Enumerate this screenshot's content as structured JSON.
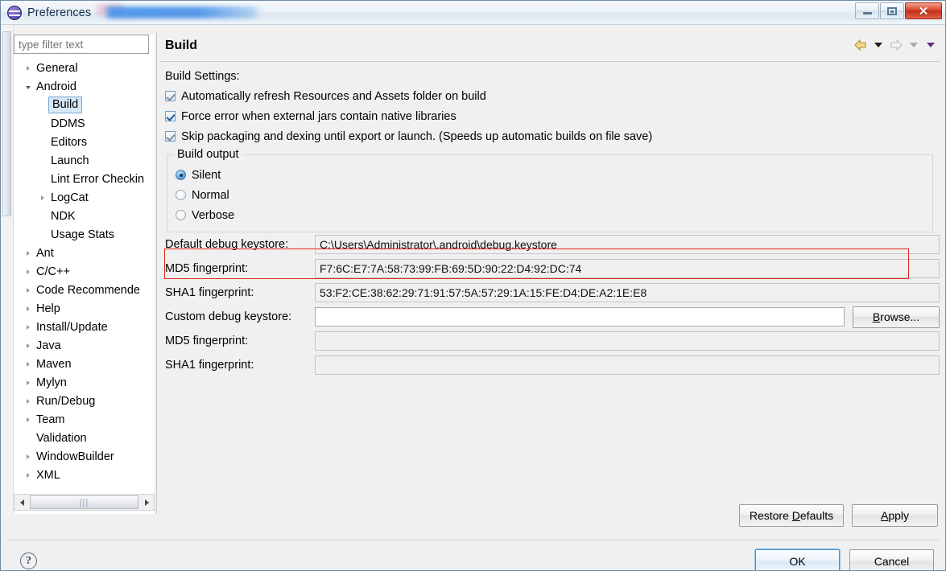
{
  "window": {
    "title": "Preferences",
    "icon": "eclipse-icon",
    "redacted_title_suffix": "",
    "controls": {
      "minimize": "minimize-button",
      "restore": "restore-button",
      "close": "✕"
    }
  },
  "sidebar": {
    "filter_placeholder": "type filter text",
    "filter_value": "",
    "selected": "Build",
    "items": [
      {
        "label": "General",
        "depth": 0,
        "twisty": "collapsed"
      },
      {
        "label": "Android",
        "depth": 0,
        "twisty": "expanded"
      },
      {
        "label": "Build",
        "depth": 1,
        "twisty": "none",
        "selected": true
      },
      {
        "label": "DDMS",
        "depth": 1,
        "twisty": "none"
      },
      {
        "label": "Editors",
        "depth": 1,
        "twisty": "none"
      },
      {
        "label": "Launch",
        "depth": 1,
        "twisty": "none"
      },
      {
        "label": "Lint Error Checkin",
        "depth": 1,
        "twisty": "none"
      },
      {
        "label": "LogCat",
        "depth": 1,
        "twisty": "collapsed"
      },
      {
        "label": "NDK",
        "depth": 1,
        "twisty": "none"
      },
      {
        "label": "Usage Stats",
        "depth": 1,
        "twisty": "none"
      },
      {
        "label": "Ant",
        "depth": 0,
        "twisty": "collapsed"
      },
      {
        "label": "C/C++",
        "depth": 0,
        "twisty": "collapsed"
      },
      {
        "label": "Code Recommende",
        "depth": 0,
        "twisty": "collapsed"
      },
      {
        "label": "Help",
        "depth": 0,
        "twisty": "collapsed"
      },
      {
        "label": "Install/Update",
        "depth": 0,
        "twisty": "collapsed"
      },
      {
        "label": "Java",
        "depth": 0,
        "twisty": "collapsed"
      },
      {
        "label": "Maven",
        "depth": 0,
        "twisty": "collapsed"
      },
      {
        "label": "Mylyn",
        "depth": 0,
        "twisty": "collapsed"
      },
      {
        "label": "Run/Debug",
        "depth": 0,
        "twisty": "collapsed"
      },
      {
        "label": "Team",
        "depth": 0,
        "twisty": "collapsed"
      },
      {
        "label": "Validation",
        "depth": 0,
        "twisty": "none"
      },
      {
        "label": "WindowBuilder",
        "depth": 0,
        "twisty": "collapsed"
      },
      {
        "label": "XML",
        "depth": 0,
        "twisty": "collapsed"
      }
    ]
  },
  "page": {
    "title": "Build",
    "nav": {
      "back": "back-arrow-icon",
      "back_menu": "back-dropdown-icon",
      "forward": "forward-arrow-icon",
      "forward_menu": "forward-dropdown-icon",
      "view_menu": "view-menu-dropdown-icon"
    },
    "build_settings_label": "Build Settings:",
    "checkboxes": [
      {
        "label": "Automatically refresh Resources and Assets folder on build",
        "checked": true,
        "dim": true
      },
      {
        "label": "Force error when external jars contain native libraries",
        "checked": true,
        "dim": false
      },
      {
        "label": "Skip packaging and dexing until export or launch. (Speeds up automatic builds on file save)",
        "checked": true,
        "dim": true
      }
    ],
    "build_output": {
      "legend": "Build output",
      "options": [
        {
          "label": "Silent",
          "selected": true
        },
        {
          "label": "Normal",
          "selected": false
        },
        {
          "label": "Verbose",
          "selected": false
        }
      ]
    },
    "fields": [
      {
        "label": "Default debug keystore:",
        "value": "C:\\Users\\Administrator\\.android\\debug.keystore",
        "readonly": true
      },
      {
        "label": "MD5 fingerprint:",
        "value": "F7:6C:E7:7A:58:73:99:FB:69:5D:90:22:D4:92:DC:74",
        "readonly": true
      },
      {
        "label": "SHA1 fingerprint:",
        "value": "53:F2:CE:38:62:29:71:91:57:5A:57:29:1A:15:FE:D4:DE:A2:1E:E8",
        "readonly": true,
        "highlighted": true
      }
    ],
    "custom": {
      "label": "Custom debug keystore:",
      "value": "",
      "browse_label": "Browse...",
      "browse_mnemonic": "B"
    },
    "custom_fields": [
      {
        "label": "MD5 fingerprint:",
        "value": ""
      },
      {
        "label": "SHA1 fingerprint:",
        "value": ""
      }
    ],
    "restore_defaults": {
      "pre": "Restore ",
      "mnemonic": "D",
      "post": "efaults"
    },
    "apply": {
      "pre": "",
      "mnemonic": "A",
      "post": "pply"
    }
  },
  "dialog": {
    "help": "?",
    "ok": "OK",
    "cancel": "Cancel"
  },
  "colors": {
    "accent_blue": "#3c93d4",
    "highlight_red": "#e2251b",
    "selection_blue": "#d6e7f7",
    "close_red": "#d9452a"
  }
}
